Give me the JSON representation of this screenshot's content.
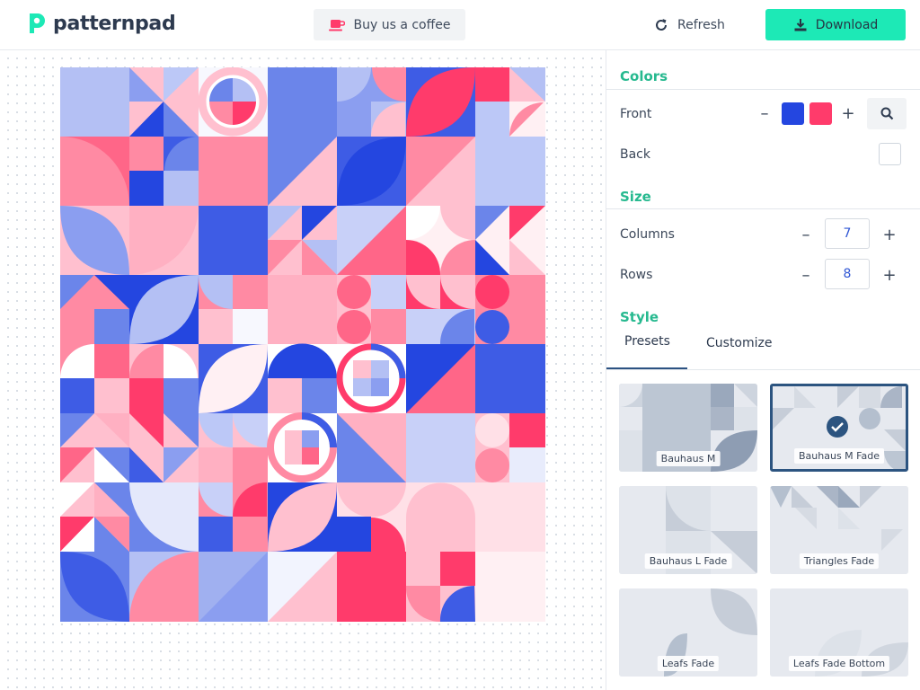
{
  "header": {
    "logo_text": "patternpad",
    "coffee_label": "Buy us a coffee",
    "refresh_label": "Refresh",
    "download_label": "Download"
  },
  "colors": {
    "accent": "#1de9b6",
    "front": [
      "#2446e0",
      "#ff3b6b"
    ],
    "back": "#ffffff"
  },
  "sidebar": {
    "colors_title": "Colors",
    "front_label": "Front",
    "back_label": "Back",
    "size_title": "Size",
    "columns_label": "Columns",
    "columns_value": "7",
    "rows_label": "Rows",
    "rows_value": "8",
    "style_title": "Style",
    "tabs": [
      {
        "label": "Presets",
        "active": true
      },
      {
        "label": "Customize",
        "active": false
      }
    ],
    "presets": [
      {
        "label": "Bauhaus M",
        "selected": false
      },
      {
        "label": "Bauhaus M Fade",
        "selected": true
      },
      {
        "label": "Bauhaus L Fade",
        "selected": false
      },
      {
        "label": "Triangles Fade",
        "selected": false
      },
      {
        "label": "Leafs Fade",
        "selected": false
      },
      {
        "label": "Leafs Fade Bottom",
        "selected": false
      }
    ]
  }
}
